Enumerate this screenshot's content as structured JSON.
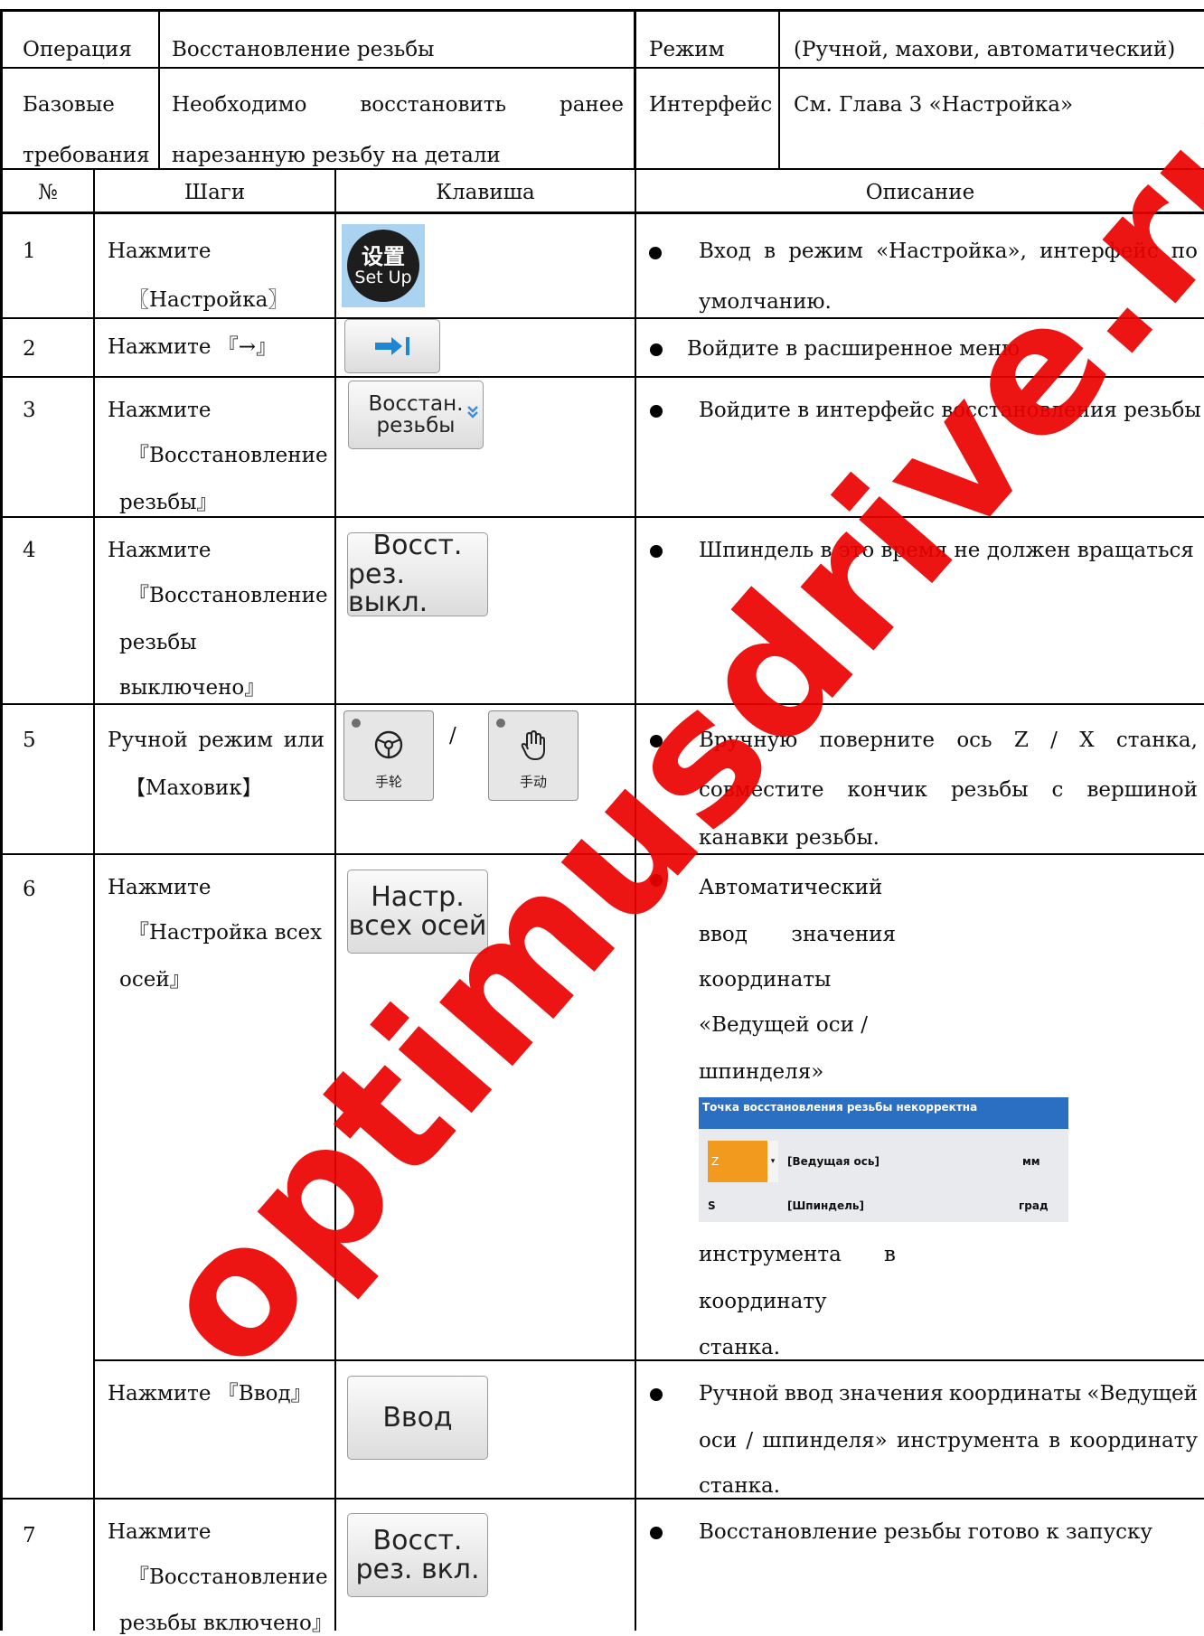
{
  "header": {
    "operation_label": "Операция",
    "operation_value": "Восстановление резьбы",
    "mode_label": "Режим",
    "mode_value": "(Ручной, махови, автоматический)",
    "base_label_1": "Базовые",
    "base_label_2": "требования",
    "base_value_words": [
      "Необходимо",
      "восстановить",
      "ранее"
    ],
    "base_value_line2": "нарезанную резьбу на детали",
    "interface_label": "Интерфейс",
    "interface_value": "См. Глава 3 «Настройка»"
  },
  "columns": [
    "№",
    "Шаги",
    "Клавиша",
    "Описание"
  ],
  "rows": [
    {
      "num": "1",
      "step": [
        "Нажмите",
        "〖Настройка〗"
      ],
      "key": {
        "type": "setup",
        "cn": "设置",
        "en": "Set Up"
      },
      "desc": {
        "line1_words": [
          "Вход",
          "в",
          "режим",
          "«Настройка»,",
          "интерфейс",
          "по"
        ],
        "line2": "умолчанию."
      }
    },
    {
      "num": "2",
      "step": [
        "Нажмите 『→』"
      ],
      "key": {
        "type": "arrow",
        "icon": "arrow-right-bar-icon"
      },
      "desc": {
        "line1": "Войдите в расширенное меню"
      }
    },
    {
      "num": "3",
      "step": [
        "Нажмите",
        "『Восстановление",
        "резьбы』"
      ],
      "key": {
        "type": "text",
        "lines": [
          "Восстан.",
          "резьбы"
        ],
        "icon": "chevron-double-down-icon"
      },
      "desc": {
        "line1": "Войдите в интерфейс восстановления резьбы"
      }
    },
    {
      "num": "4",
      "step": [
        "Нажмите",
        "『Восстановление",
        "резьбы",
        "выключено』"
      ],
      "key": {
        "type": "text",
        "lines": [
          "Восст.",
          "рез. выкл."
        ]
      },
      "desc": {
        "line1": "Шпиндель в это время не должен вращаться"
      }
    },
    {
      "num": "5",
      "step_words": [
        "Ручной",
        "режим",
        "или"
      ],
      "step_line2": "【Маховик】",
      "key": {
        "type": "hw",
        "sep": "/",
        "buttons": [
          {
            "icon": "handwheel-icon",
            "label": "手轮"
          },
          {
            "icon": "hand-icon",
            "label": "手动"
          }
        ]
      },
      "desc": {
        "line1_words": [
          "Вручную",
          "поверните",
          "ось",
          "Z",
          "/",
          "X",
          "станка,"
        ],
        "line2_words": [
          "совместите",
          "кончик",
          "резьбы",
          "с",
          "вершиной"
        ],
        "line3": "канавки резьбы."
      }
    },
    {
      "num": "6",
      "step": [
        "Нажмите",
        "『Настройка всех",
        "осей』"
      ],
      "key": {
        "type": "text",
        "lines": [
          "Настр.",
          "всех осей"
        ]
      },
      "desc": {
        "lines": [
          "Автоматический",
          "ввод значения",
          "координаты",
          "«Ведущей оси /",
          "шпинделя»"
        ],
        "lines_after": [
          "инструмента в",
          "координату",
          "станка."
        ],
        "dialog": {
          "title": "Точка восстановления резьбы некорректна",
          "axis": "Z",
          "lead_axis": "[Ведущая ось]",
          "unit1": "мм",
          "spindle_code": "S",
          "spindle": "[Шпиндель]",
          "unit2": "град"
        }
      }
    },
    {
      "num": "",
      "step": [
        "Нажмите 『Ввод』"
      ],
      "key": {
        "type": "text",
        "lines": [
          "Ввод"
        ]
      },
      "desc": {
        "line1_words": [
          "Ручной",
          "ввод",
          "значения",
          "координаты",
          "«Ведущей"
        ],
        "line2_words": [
          "оси",
          "/",
          "шпинделя»",
          "инструмента",
          "в",
          "координату"
        ],
        "line3": "станка."
      }
    },
    {
      "num": "7",
      "step": [
        "Нажмите",
        "『Восстановление",
        "резьбы включено』"
      ],
      "key": {
        "type": "text",
        "lines": [
          "Восст.",
          "рез. вкл."
        ]
      },
      "desc": {
        "line1": "Восстановление резьбы готово к запуску"
      }
    }
  ],
  "watermark": "optimusdrive.ru",
  "colors": {
    "watermark": "#ec0000",
    "dialog_title": "#2b6fc2",
    "dialog_select": "#f29a1e",
    "setup_bg": "#a9d3f0",
    "arrow": "#1f86d6"
  }
}
